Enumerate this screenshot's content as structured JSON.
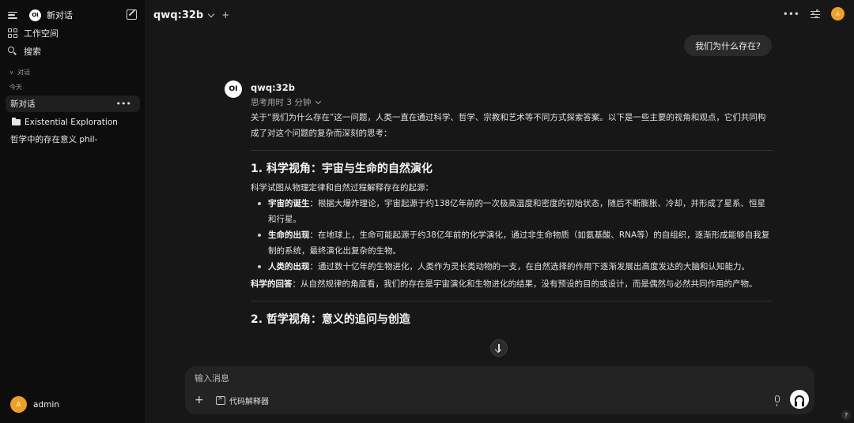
{
  "sidebar": {
    "title": "新对话",
    "workspace_label": "工作空间",
    "search_label": "搜索",
    "section_chats": "对话",
    "section_today": "今天",
    "chats": [
      {
        "label": "新对话"
      },
      {
        "label": "Existential Exploration"
      },
      {
        "label": "哲学中的存在意义 phil-"
      }
    ],
    "user": {
      "avatar": "A",
      "name": "admin"
    }
  },
  "header": {
    "model": "qwq:32b",
    "avatar": "A"
  },
  "conversation": {
    "user_message": "我们为什么存在?",
    "ai_logo": "OI",
    "ai_name": "qwq:32b",
    "thinking": "思考用时 3 分钟",
    "intro": "关于“我们为什么存在”这一问题，人类一直在通过科学、哲学、宗教和艺术等不同方式探索答案。以下是一些主要的视角和观点，它们共同构成了对这个问题的复杂而深刻的思考：",
    "section1": {
      "title": "1. 科学视角：宇宙与生命的自然演化",
      "lead": "科学试图从物理定律和自然过程解释存在的起源：",
      "bullets": [
        {
          "term": "宇宙的诞生",
          "text": "：根据大爆炸理论，宇宙起源于约138亿年前的一次极高温度和密度的初始状态，随后不断膨胀、冷却，并形成了星系、恒星和行星。"
        },
        {
          "term": "生命的出现",
          "text": "：在地球上，生命可能起源于约38亿年前的化学演化，通过非生命物质（如氨基酸、RNA等）的自组织，逐渐形成能够自我复制的系统，最终演化出复杂的生物。"
        },
        {
          "term": "人类的出现",
          "text": "：通过数十亿年的生物进化，人类作为灵长类动物的一支，在自然选择的作用下逐渐发展出高度发达的大脑和认知能力。"
        }
      ],
      "conclusion_term": "科学的回答",
      "conclusion_text": "：从自然规律的角度看，我们的存在是宇宙演化和生物进化的结果，没有预设的目的或设计，而是偶然与必然共同作用的产物。"
    },
    "section2": {
      "title": "2. 哲学视角：意义的追问与创造"
    }
  },
  "composer": {
    "placeholder": "输入消息",
    "tool_label": "代码解释器"
  },
  "help": "?"
}
